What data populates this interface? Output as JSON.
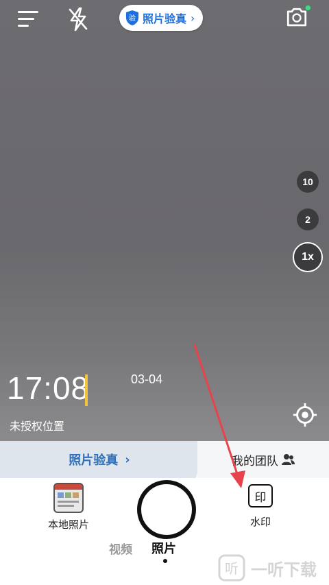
{
  "header": {
    "verify_pill": {
      "badge": "验",
      "label": "照片验真",
      "chevron": "›"
    },
    "icons": [
      "menu-icon",
      "flash-off-icon",
      "switch-camera-icon"
    ],
    "status_dot_color": "#3ddc84"
  },
  "zoom": {
    "levels": [
      "10",
      "2",
      "1x"
    ],
    "selected": "1x"
  },
  "watermark_overlay": {
    "time": "17:08",
    "date": "03-04",
    "location": "未授权位置",
    "accent_color": "#f4c33a"
  },
  "strip": {
    "left_label": "照片验真",
    "left_chevron": "›",
    "right_label": "我的团队"
  },
  "bottom": {
    "local_photos_label": "本地照片",
    "watermark_label": "水印",
    "watermark_glyph": "印",
    "modes": {
      "video": "视频",
      "photo": "照片"
    },
    "active_mode": "photo"
  },
  "site_watermark": {
    "glyph": "听",
    "text": "一听下载"
  },
  "colors": {
    "brand_blue": "#1d6fdf",
    "annotation_arrow": "#e8434c"
  }
}
